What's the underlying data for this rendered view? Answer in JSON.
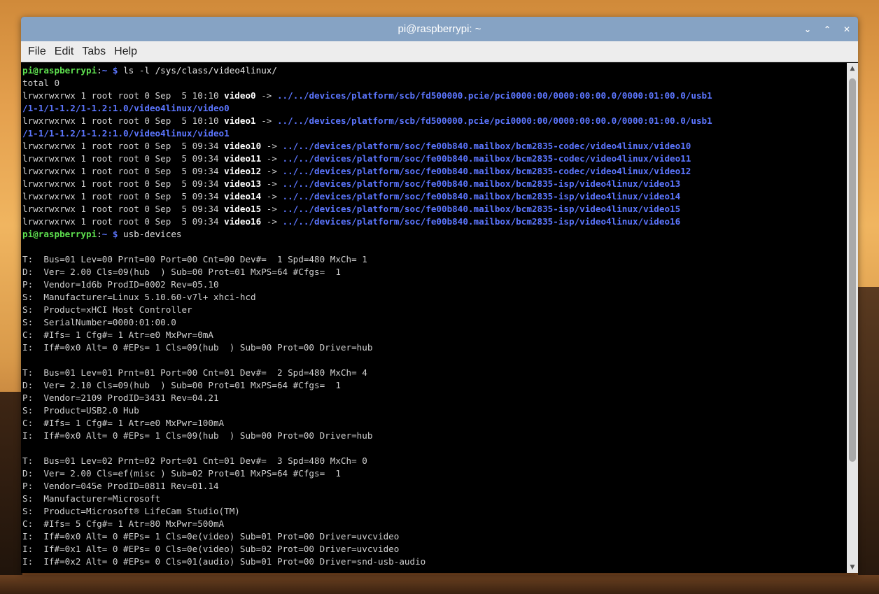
{
  "window": {
    "title": "pi@raspberrypi: ~",
    "controls": {
      "minimize": "⌄",
      "maximize": "⌃",
      "close": "✕"
    }
  },
  "menu": [
    "File",
    "Edit",
    "Tabs",
    "Help"
  ],
  "colors": {
    "titlebar": "#86a3c4",
    "prompt": "#5ee04f",
    "path": "#5c76ff",
    "link": "#5c76ff",
    "text": "#d0d0d0",
    "background": "#000000"
  },
  "terminal": {
    "lines": [
      [
        {
          "t": "pi@raspberrypi",
          "c": "prompt"
        },
        {
          "t": ":",
          "c": "cmd"
        },
        {
          "t": "~",
          "c": "path"
        },
        {
          "t": " $ ",
          "c": "path"
        },
        {
          "t": "ls -l /sys/class/video4linux/",
          "c": "cmd"
        }
      ],
      [
        {
          "t": "total 0",
          "c": "txt"
        }
      ],
      [
        {
          "t": "lrwxrwxrwx 1 root root 0 Sep  5 10:10 ",
          "c": "txt"
        },
        {
          "t": "video0",
          "c": "vid"
        },
        {
          "t": " -> ",
          "c": "txt"
        },
        {
          "t": "../../devices/platform/scb/fd500000.pcie/pci0000:00/0000:00:00.0/0000:01:00.0/usb1",
          "c": "lnk"
        }
      ],
      [
        {
          "t": "/1-1/1-1.2/1-1.2:1.0/video4linux/video0",
          "c": "lnk"
        }
      ],
      [
        {
          "t": "lrwxrwxrwx 1 root root 0 Sep  5 10:10 ",
          "c": "txt"
        },
        {
          "t": "video1",
          "c": "vid"
        },
        {
          "t": " -> ",
          "c": "txt"
        },
        {
          "t": "../../devices/platform/scb/fd500000.pcie/pci0000:00/0000:00:00.0/0000:01:00.0/usb1",
          "c": "lnk"
        }
      ],
      [
        {
          "t": "/1-1/1-1.2/1-1.2:1.0/video4linux/video1",
          "c": "lnk"
        }
      ],
      [
        {
          "t": "lrwxrwxrwx 1 root root 0 Sep  5 09:34 ",
          "c": "txt"
        },
        {
          "t": "video10",
          "c": "vid"
        },
        {
          "t": " -> ",
          "c": "txt"
        },
        {
          "t": "../../devices/platform/soc/fe00b840.mailbox/bcm2835-codec/video4linux/video10",
          "c": "lnk"
        }
      ],
      [
        {
          "t": "lrwxrwxrwx 1 root root 0 Sep  5 09:34 ",
          "c": "txt"
        },
        {
          "t": "video11",
          "c": "vid"
        },
        {
          "t": " -> ",
          "c": "txt"
        },
        {
          "t": "../../devices/platform/soc/fe00b840.mailbox/bcm2835-codec/video4linux/video11",
          "c": "lnk"
        }
      ],
      [
        {
          "t": "lrwxrwxrwx 1 root root 0 Sep  5 09:34 ",
          "c": "txt"
        },
        {
          "t": "video12",
          "c": "vid"
        },
        {
          "t": " -> ",
          "c": "txt"
        },
        {
          "t": "../../devices/platform/soc/fe00b840.mailbox/bcm2835-codec/video4linux/video12",
          "c": "lnk"
        }
      ],
      [
        {
          "t": "lrwxrwxrwx 1 root root 0 Sep  5 09:34 ",
          "c": "txt"
        },
        {
          "t": "video13",
          "c": "vid"
        },
        {
          "t": " -> ",
          "c": "txt"
        },
        {
          "t": "../../devices/platform/soc/fe00b840.mailbox/bcm2835-isp/video4linux/video13",
          "c": "lnk"
        }
      ],
      [
        {
          "t": "lrwxrwxrwx 1 root root 0 Sep  5 09:34 ",
          "c": "txt"
        },
        {
          "t": "video14",
          "c": "vid"
        },
        {
          "t": " -> ",
          "c": "txt"
        },
        {
          "t": "../../devices/platform/soc/fe00b840.mailbox/bcm2835-isp/video4linux/video14",
          "c": "lnk"
        }
      ],
      [
        {
          "t": "lrwxrwxrwx 1 root root 0 Sep  5 09:34 ",
          "c": "txt"
        },
        {
          "t": "video15",
          "c": "vid"
        },
        {
          "t": " -> ",
          "c": "txt"
        },
        {
          "t": "../../devices/platform/soc/fe00b840.mailbox/bcm2835-isp/video4linux/video15",
          "c": "lnk"
        }
      ],
      [
        {
          "t": "lrwxrwxrwx 1 root root 0 Sep  5 09:34 ",
          "c": "txt"
        },
        {
          "t": "video16",
          "c": "vid"
        },
        {
          "t": " -> ",
          "c": "txt"
        },
        {
          "t": "../../devices/platform/soc/fe00b840.mailbox/bcm2835-isp/video4linux/video16",
          "c": "lnk"
        }
      ],
      [
        {
          "t": "pi@raspberrypi",
          "c": "prompt"
        },
        {
          "t": ":",
          "c": "cmd"
        },
        {
          "t": "~",
          "c": "path"
        },
        {
          "t": " $ ",
          "c": "path"
        },
        {
          "t": "usb-devices",
          "c": "cmd"
        }
      ],
      [
        {
          "t": "",
          "c": "txt"
        }
      ],
      [
        {
          "t": "T:  Bus=01 Lev=00 Prnt=00 Port=00 Cnt=00 Dev#=  1 Spd=480 MxCh= 1",
          "c": "txt"
        }
      ],
      [
        {
          "t": "D:  Ver= 2.00 Cls=09(hub  ) Sub=00 Prot=01 MxPS=64 #Cfgs=  1",
          "c": "txt"
        }
      ],
      [
        {
          "t": "P:  Vendor=1d6b ProdID=0002 Rev=05.10",
          "c": "txt"
        }
      ],
      [
        {
          "t": "S:  Manufacturer=Linux 5.10.60-v7l+ xhci-hcd",
          "c": "txt"
        }
      ],
      [
        {
          "t": "S:  Product=xHCI Host Controller",
          "c": "txt"
        }
      ],
      [
        {
          "t": "S:  SerialNumber=0000:01:00.0",
          "c": "txt"
        }
      ],
      [
        {
          "t": "C:  #Ifs= 1 Cfg#= 1 Atr=e0 MxPwr=0mA",
          "c": "txt"
        }
      ],
      [
        {
          "t": "I:  If#=0x0 Alt= 0 #EPs= 1 Cls=09(hub  ) Sub=00 Prot=00 Driver=hub",
          "c": "txt"
        }
      ],
      [
        {
          "t": "",
          "c": "txt"
        }
      ],
      [
        {
          "t": "T:  Bus=01 Lev=01 Prnt=01 Port=00 Cnt=01 Dev#=  2 Spd=480 MxCh= 4",
          "c": "txt"
        }
      ],
      [
        {
          "t": "D:  Ver= 2.10 Cls=09(hub  ) Sub=00 Prot=01 MxPS=64 #Cfgs=  1",
          "c": "txt"
        }
      ],
      [
        {
          "t": "P:  Vendor=2109 ProdID=3431 Rev=04.21",
          "c": "txt"
        }
      ],
      [
        {
          "t": "S:  Product=USB2.0 Hub",
          "c": "txt"
        }
      ],
      [
        {
          "t": "C:  #Ifs= 1 Cfg#= 1 Atr=e0 MxPwr=100mA",
          "c": "txt"
        }
      ],
      [
        {
          "t": "I:  If#=0x0 Alt= 0 #EPs= 1 Cls=09(hub  ) Sub=00 Prot=00 Driver=hub",
          "c": "txt"
        }
      ],
      [
        {
          "t": "",
          "c": "txt"
        }
      ],
      [
        {
          "t": "T:  Bus=01 Lev=02 Prnt=02 Port=01 Cnt=01 Dev#=  3 Spd=480 MxCh= 0",
          "c": "txt"
        }
      ],
      [
        {
          "t": "D:  Ver= 2.00 Cls=ef(misc ) Sub=02 Prot=01 MxPS=64 #Cfgs=  1",
          "c": "txt"
        }
      ],
      [
        {
          "t": "P:  Vendor=045e ProdID=0811 Rev=01.14",
          "c": "txt"
        }
      ],
      [
        {
          "t": "S:  Manufacturer=Microsoft",
          "c": "txt"
        }
      ],
      [
        {
          "t": "S:  Product=Microsoft® LifeCam Studio(TM)",
          "c": "txt"
        }
      ],
      [
        {
          "t": "C:  #Ifs= 5 Cfg#= 1 Atr=80 MxPwr=500mA",
          "c": "txt"
        }
      ],
      [
        {
          "t": "I:  If#=0x0 Alt= 0 #EPs= 1 Cls=0e(video) Sub=01 Prot=00 Driver=uvcvideo",
          "c": "txt"
        }
      ],
      [
        {
          "t": "I:  If#=0x1 Alt= 0 #EPs= 0 Cls=0e(video) Sub=02 Prot=00 Driver=uvcvideo",
          "c": "txt"
        }
      ],
      [
        {
          "t": "I:  If#=0x2 Alt= 0 #EPs= 0 Cls=01(audio) Sub=01 Prot=00 Driver=snd-usb-audio",
          "c": "txt"
        }
      ]
    ]
  },
  "scrollbar": {
    "up": "▲",
    "down": "▼"
  }
}
